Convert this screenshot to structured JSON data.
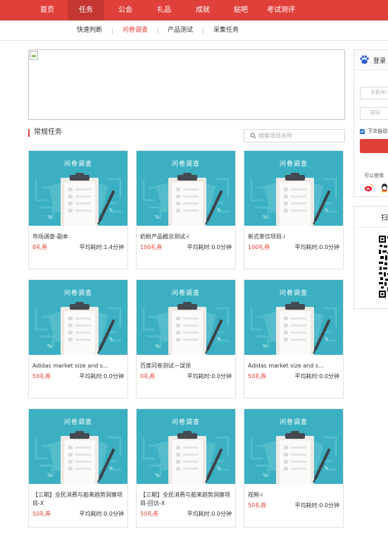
{
  "top_nav": [
    "首页",
    "任务",
    "公会",
    "礼品",
    "成就",
    "贴吧",
    "考试测评"
  ],
  "active_top": "任务",
  "sub_nav": [
    "快速判断",
    "问卷调查",
    "产品测试",
    "采集任务"
  ],
  "active_sub": "问卷调查",
  "section": {
    "title": "常规任务"
  },
  "search": {
    "placeholder": "搜索项目名称"
  },
  "thumbnail_title": "问卷调查",
  "colors": {
    "brand": "#e0403a",
    "thumb_bg": "#3bb0c2"
  },
  "cards": [
    {
      "title": "市场调查-副本",
      "reward": "8礼券",
      "time": "平均耗时:1.4分钟"
    },
    {
      "title": "奶粉产品概念测试-i",
      "reward": "100礼券",
      "time": "平均耗时:0.0分钟"
    },
    {
      "title": "新式茶饮项目-i",
      "reward": "100礼券",
      "time": "平均耗时:0.0分钟"
    },
    {
      "title": "Adidas market size and s...",
      "reward": "50礼券",
      "time": "平均耗时:0.0分钟"
    },
    {
      "title": "百度问卷测试—误领",
      "reward": "0礼券",
      "time": "平均耗时:0.0分钟"
    },
    {
      "title": "Adidas market size and s...",
      "reward": "50礼券",
      "time": "平均耗时:0.0分钟"
    },
    {
      "title": "【三期】全民消费与舶来趋势洞察项目-X",
      "reward": "50礼券",
      "time": "平均耗时:0.0分钟"
    },
    {
      "title": "【三期】全民消费与舶来趋势洞察项目-回访-X",
      "reward": "50礼券",
      "time": "平均耗时:0.0分钟"
    },
    {
      "title": "视频-i",
      "reward": "50礼券",
      "time": "平均耗时:0.0分钟"
    }
  ],
  "login": {
    "title": "登录",
    "phone_placeholder": "手机号/",
    "password_placeholder": "密码",
    "remember_label": "下次自动",
    "hint": "可以使用"
  },
  "qr": {
    "label": "扫"
  }
}
